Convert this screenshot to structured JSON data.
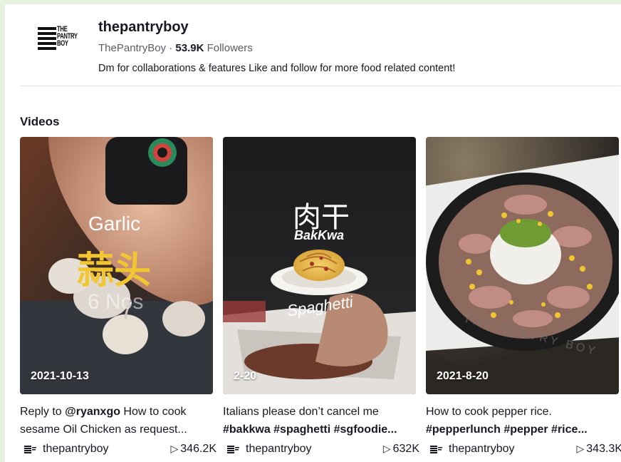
{
  "profile": {
    "logo_lines": [
      "THE",
      "PANTRY",
      "BOY"
    ],
    "username": "thepantryboy",
    "display_name": "ThePantryBoy",
    "separator": " · ",
    "followers_count": "53.9K",
    "followers_label": " Followers",
    "bio": "Dm for collaborations & features Like and follow for more food related content!"
  },
  "section_title": "Videos",
  "videos": [
    {
      "date": "2021-10-13",
      "overlay_text": [
        "Garlic",
        "蒜头",
        "6 Nos"
      ],
      "caption_prefix": "Reply to ",
      "caption_mention": "@ryanxgo",
      "caption_line1_rest": " How to cook",
      "caption_line2": "sesame Oil Chicken as request...",
      "author": "thepantryboy",
      "views": "346.2K"
    },
    {
      "date": "2-20",
      "overlay_text": [
        "肉干",
        "BakKwa",
        "Spaghetti"
      ],
      "caption_line1": "Italians please don’t cancel me",
      "caption_line2": "#bakkwa #spaghetti #sgfoodie...",
      "author": "thepantryboy",
      "views": "632K"
    },
    {
      "date": "2021-8-20",
      "overlay_text": [
        "THE PANTRY BOY"
      ],
      "caption_line1": "How to cook pepper rice.",
      "caption_line2": "#pepperlunch #pepper #rice...",
      "author": "thepantryboy",
      "views": "343.3K"
    }
  ],
  "icons": {
    "play": "play-icon",
    "author": "user-logo-icon"
  },
  "colors": {
    "text": "#161823",
    "muted": "#5b5d66",
    "frame": "#e7f1df"
  }
}
